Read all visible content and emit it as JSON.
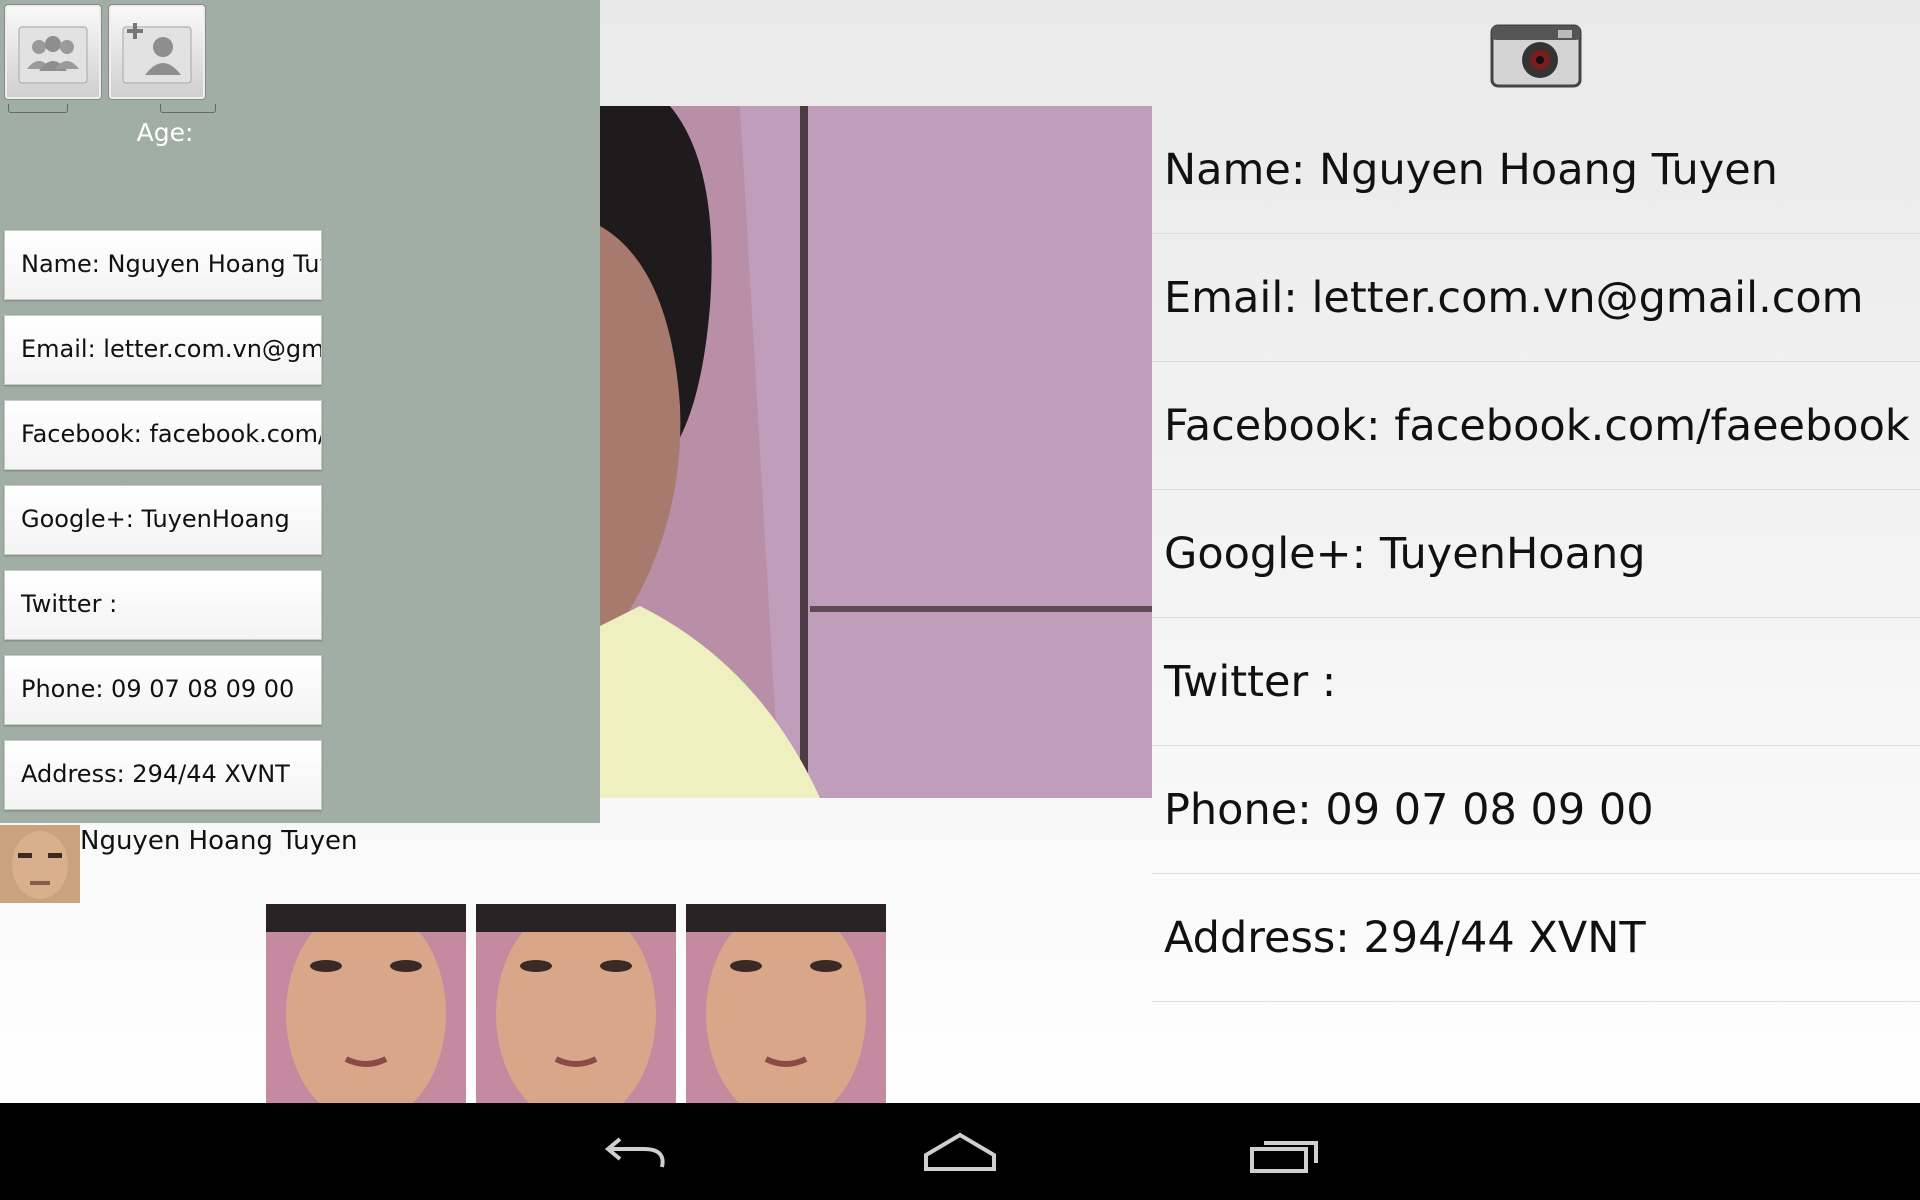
{
  "left_panel": {
    "age_label": "Age:",
    "fields": [
      "Name: Nguyen Hoang Tuyen",
      "Email: letter.com.vn@gmail.com",
      "Facebook: facebook.com/faeebook",
      "Google+: TuyenHoang",
      "Twitter :",
      "Phone: 09 07 08 09 00",
      "Address: 294/44 XVNT"
    ]
  },
  "contact_caption": "Nguyen Hoang Tuyen",
  "info_list": [
    "Name: Nguyen Hoang Tuyen",
    "Email: letter.com.vn@gmail.com",
    "Facebook: facebook.com/faeebook",
    "Google+: TuyenHoang",
    "Twitter :",
    "Phone: 09 07 08 09 00",
    "Address: 294/44 XVNT"
  ],
  "icons": {
    "contacts": "contacts-group-icon",
    "add_contact": "add-contact-icon",
    "camera": "camera-icon",
    "back": "back-icon",
    "home": "home-icon",
    "recent": "recent-apps-icon"
  },
  "colors": {
    "left_panel": "#a1aea5",
    "nav_bar": "#000000"
  }
}
